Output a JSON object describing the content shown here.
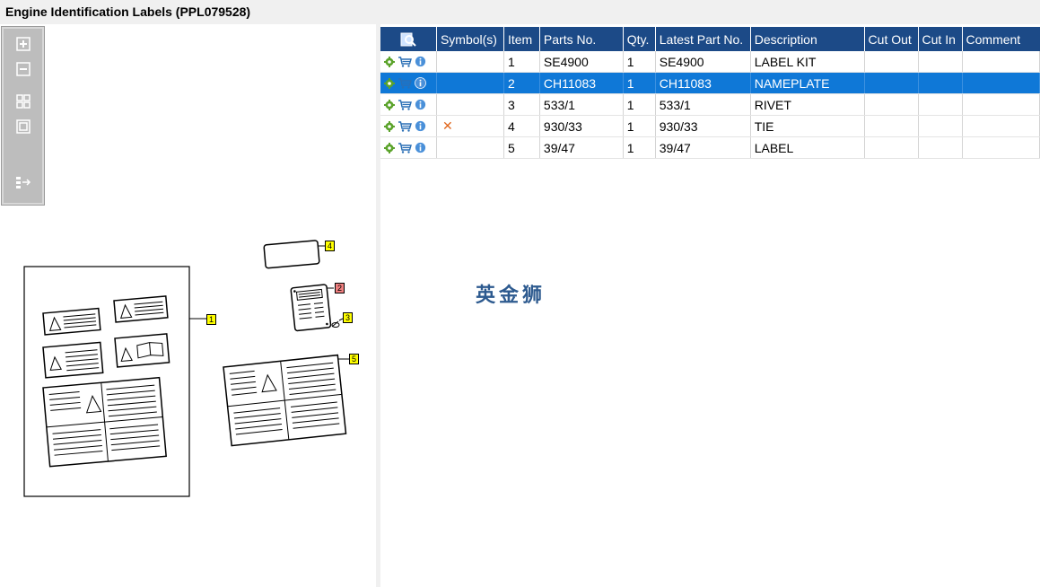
{
  "window": {
    "title": "Engine Identification Labels (PPL079528)"
  },
  "toolbar": {
    "buttons": [
      {
        "name": "zoom-in-button",
        "icon": "plus-icon"
      },
      {
        "name": "zoom-out-button",
        "icon": "minus-icon"
      },
      {
        "name": "fit-all-button",
        "icon": "fit-grid-icon"
      },
      {
        "name": "fit-window-button",
        "icon": "square-icon"
      },
      {
        "name": "export-button",
        "icon": "export-arrow-icon"
      }
    ]
  },
  "diagram": {
    "callouts": [
      {
        "label": "1",
        "style": "yellow"
      },
      {
        "label": "2",
        "style": "red"
      },
      {
        "label": "3",
        "style": "yellow"
      },
      {
        "label": "4",
        "style": "yellow"
      },
      {
        "label": "5",
        "style": "yellow"
      }
    ]
  },
  "table": {
    "columns": [
      "Symbol(s)",
      "Item",
      "Parts No.",
      "Qty.",
      "Latest Part No.",
      "Description",
      "Cut Out",
      "Cut In",
      "Comment"
    ],
    "rows": [
      {
        "symbol": "",
        "item": "1",
        "parts_no": "SE4900",
        "qty": "1",
        "latest": "SE4900",
        "description": "LABEL KIT",
        "cut_out": "",
        "cut_in": "",
        "comment": ""
      },
      {
        "symbol": "",
        "item": "2",
        "parts_no": "CH11083",
        "qty": "1",
        "latest": "CH11083",
        "description": "NAMEPLATE",
        "cut_out": "",
        "cut_in": "",
        "comment": "",
        "selected": true
      },
      {
        "symbol": "",
        "item": "3",
        "parts_no": "533/1",
        "qty": "1",
        "latest": "533/1",
        "description": "RIVET",
        "cut_out": "",
        "cut_in": "",
        "comment": ""
      },
      {
        "symbol": "✕",
        "item": "4",
        "parts_no": "930/33",
        "qty": "1",
        "latest": "930/33",
        "description": "TIE",
        "cut_out": "",
        "cut_in": "",
        "comment": ""
      },
      {
        "symbol": "",
        "item": "5",
        "parts_no": "39/47",
        "qty": "1",
        "latest": "39/47",
        "description": "LABEL",
        "cut_out": "",
        "cut_in": "",
        "comment": ""
      }
    ],
    "header_color": "#1c4a87",
    "selected_color": "#0f78d7"
  },
  "watermark": {
    "text": "英金狮"
  }
}
